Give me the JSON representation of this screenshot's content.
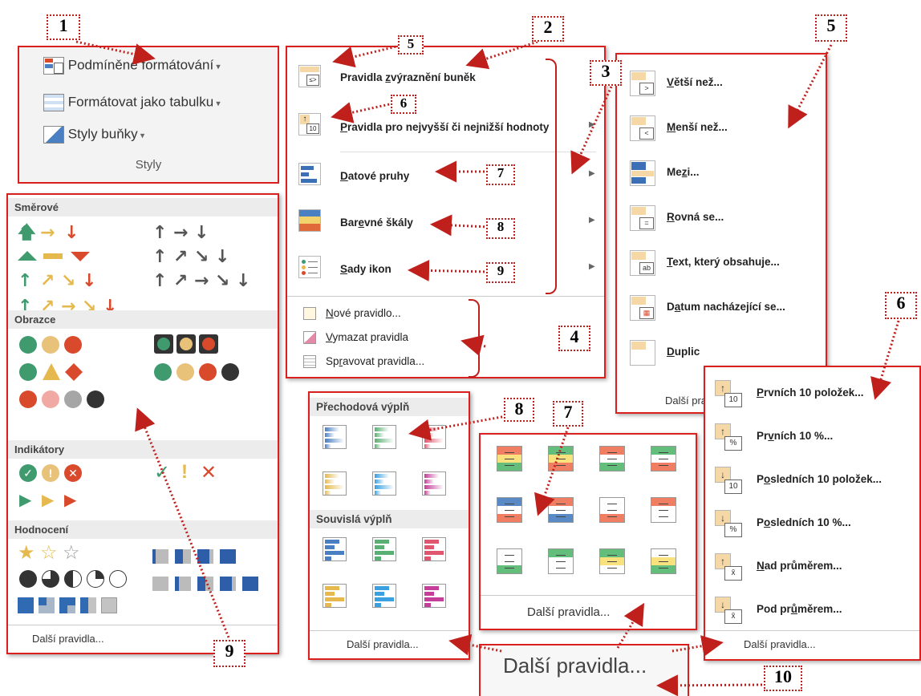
{
  "callouts": [
    "1",
    "2",
    "3",
    "4",
    "5",
    "6",
    "7",
    "8",
    "9",
    "10"
  ],
  "ribbon": {
    "items": [
      "Podmíněné formátování",
      "Formátovat jako tabulku",
      "Styly buňky"
    ],
    "group_label": "Styly"
  },
  "cf_menu": {
    "main": [
      {
        "prefix": "Pravidla ",
        "u": "z",
        "rest": "výraznění buněk"
      },
      {
        "prefix": "",
        "u": "P",
        "rest": "ravidla pro nejvyšší či nejnižší hodnoty"
      },
      {
        "prefix": "",
        "u": "D",
        "rest": "atové pruhy"
      },
      {
        "prefix": "Bar",
        "u": "e",
        "rest": "vné škály"
      },
      {
        "prefix": "",
        "u": "S",
        "rest": "ady ikon"
      }
    ],
    "bottom": [
      {
        "prefix": "",
        "u": "N",
        "rest": "ové pravidlo..."
      },
      {
        "prefix": "",
        "u": "V",
        "rest": "ymazat pravidla"
      },
      {
        "prefix": "Sp",
        "u": "r",
        "rest": "avovat pravidla..."
      }
    ]
  },
  "highlight_menu": {
    "items": [
      {
        "prefix": "",
        "u": "V",
        "rest": "ětší než..."
      },
      {
        "prefix": "",
        "u": "M",
        "rest": "enší než..."
      },
      {
        "prefix": "Me",
        "u": "z",
        "rest": "i..."
      },
      {
        "prefix": "",
        "u": "R",
        "rest": "ovná se..."
      },
      {
        "prefix": "",
        "u": "T",
        "rest": "ext, který obsahuje..."
      },
      {
        "prefix": "D",
        "u": "a",
        "rest": "tum nacházející se..."
      },
      {
        "prefix": "",
        "u": "D",
        "rest": "uplic"
      }
    ],
    "more": "Další prav"
  },
  "topbottom_menu": {
    "items": [
      {
        "prefix": "",
        "u": "P",
        "rest": "rvních 10 položek..."
      },
      {
        "prefix": "Pr",
        "u": "v",
        "rest": "ních 10 %..."
      },
      {
        "prefix": "P",
        "u": "o",
        "rest": "sledních 10 položek..."
      },
      {
        "prefix": "P",
        "u": "o",
        "rest": "sledních 10 %..."
      },
      {
        "prefix": "",
        "u": "N",
        "rest": "ad průměrem..."
      },
      {
        "prefix": "Pod pr",
        "u": "ů",
        "rest": "měrem..."
      }
    ],
    "more": "Další pravidla..."
  },
  "icon_sets": {
    "sections": [
      "Směrové",
      "Obrazce",
      "Indikátory",
      "Hodnocení"
    ],
    "more": "Další pravidla..."
  },
  "data_bars": {
    "gradient_label": "Přechodová výplň",
    "solid_label": "Souvislá výplň",
    "more": "Další pravidla..."
  },
  "color_scales": {
    "more": "Další pravidla..."
  },
  "zoom_label": "Další pravidla...",
  "colors": {
    "callout_border": "#d9201f",
    "green": "#3f9a6e",
    "yellow": "#e5b94e",
    "red": "#d94a2c"
  }
}
